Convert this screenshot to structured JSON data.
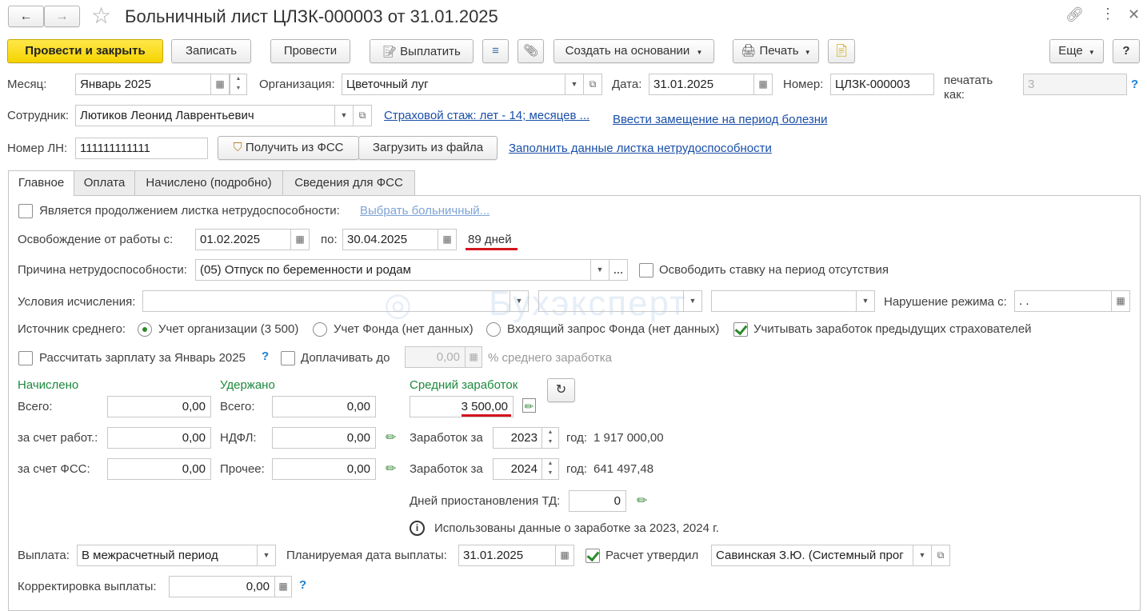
{
  "window": {
    "title": "Больничный лист ЦЛЗК-000003 от 31.01.2025"
  },
  "toolbar": {
    "post_close": "Провести и закрыть",
    "save": "Записать",
    "post": "Провести",
    "pay": "Выплатить",
    "create_based": "Создать на основании",
    "print": "Печать",
    "more": "Еще",
    "help": "?"
  },
  "header": {
    "month_label": "Месяц:",
    "month_value": "Январь 2025",
    "org_label": "Организация:",
    "org_value": "Цветочный луг",
    "date_label": "Дата:",
    "date_value": "31.01.2025",
    "number_label": "Номер:",
    "number_value": "ЦЛЗК-000003",
    "print_as_label_1": "печатать",
    "print_as_label_2": "как:",
    "print_as_value": "3",
    "help_mark": "?",
    "employee_label": "Сотрудник:",
    "employee_value": "Лютиков Леонид Лаврентьевич",
    "insurance_link": "Страховой стаж: лет - 14; месяцев ...",
    "substitute_link": "Ввести замещение на период болезни",
    "ln_label": "Номер ЛН:",
    "ln_value": "111111111111",
    "get_fss": "Получить из ФСС",
    "load_file": "Загрузить из файла",
    "fill_link": "Заполнить данные листка нетрудоспособности"
  },
  "tabs": [
    {
      "label": "Главное"
    },
    {
      "label": "Оплата"
    },
    {
      "label": "Начислено (подробно)"
    },
    {
      "label": "Сведения для ФСС"
    }
  ],
  "main": {
    "continuation_label": "Является продолжением листка нетрудоспособности:",
    "choose_sick_link": "Выбрать больничный...",
    "release_label": "Освобождение от работы с:",
    "release_from": "01.02.2025",
    "to_label": "по:",
    "release_to": "30.04.2025",
    "days": "89 дней",
    "reason_label": "Причина нетрудоспособности:",
    "reason_value": "(05) Отпуск по беременности и родам",
    "free_rate_label": "Освободить ставку на период отсутствия",
    "conditions_label": "Условия исчисления:",
    "violation_label": "Нарушение режима с:",
    "violation_value": " .  .",
    "avg_source_label": "Источник среднего:",
    "source_org": "Учет организации (3 500)",
    "source_fund": "Учет Фонда (нет данных)",
    "source_request": "Входящий запрос Фонда (нет данных)",
    "prev_insurers": "Учитывать заработок предыдущих страхователей",
    "calc_salary_label": "Рассчитать зарплату за Январь 2025",
    "topup_label": "Доплачивать до",
    "topup_value": "0,00",
    "avg_percent_label": "% среднего заработка",
    "watermark": "Бухэксперт"
  },
  "accrued": {
    "title": "Начислено",
    "total_label": "Всего:",
    "total": "0,00",
    "employer_label": "за счет работ.:",
    "employer": "0,00",
    "fss_label": "за счет ФСС:",
    "fss": "0,00"
  },
  "withheld": {
    "title": "Удержано",
    "total_label": "Всего:",
    "total": "0,00",
    "ndfl_label": "НДФЛ:",
    "ndfl": "0,00",
    "other_label": "Прочее:",
    "other": "0,00"
  },
  "average": {
    "title": "Средний заработок",
    "value": "3 500,00",
    "earnings_label": "Заработок за",
    "year1": "2023",
    "year_label": "год:",
    "amount1": "1 917 000,00",
    "year2": "2024",
    "amount2": "641 497,48",
    "suspension_label": "Дней приостановления ТД:",
    "suspension_value": "0",
    "info_text": "Использованы данные о заработке за  2023,  2024 г."
  },
  "payment": {
    "label": "Выплата:",
    "value": "В межрасчетный период",
    "planned_label": "Планируемая дата выплаты:",
    "planned_value": "31.01.2025",
    "approved_label": "Расчет утвердил",
    "approved_value": "Савинская З.Ю. (Системный прог",
    "correction_label": "Корректировка выплаты:",
    "correction_value": "0,00"
  },
  "colors": {
    "primary_button": "#f5d300",
    "link": "#1a4fa8",
    "section_title": "#1c8a3c",
    "highlight_underline": "#d4141c"
  }
}
